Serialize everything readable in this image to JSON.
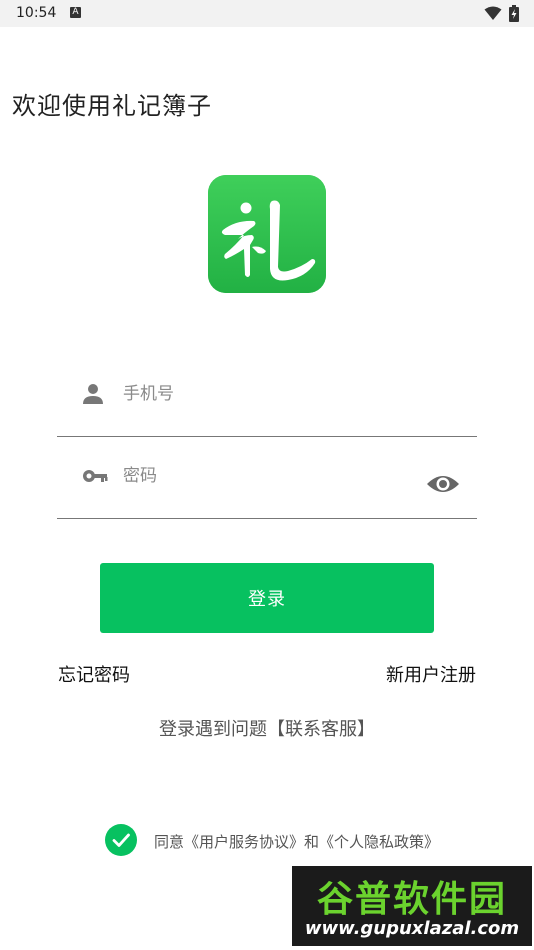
{
  "status_bar": {
    "time": "10:54",
    "notification_glyph": "A",
    "icons": [
      "wifi-icon",
      "battery-charging-icon"
    ]
  },
  "welcome_title": "欢迎使用礼记簿子",
  "logo": {
    "text": "礼",
    "color": "#2fbf4f"
  },
  "form": {
    "phone_placeholder": "手机号",
    "password_placeholder": "密码",
    "phone_icon": "person-icon",
    "password_icon": "key-icon",
    "toggle_icon": "eye-icon"
  },
  "login_button": {
    "label": "登录",
    "color": "#07c160"
  },
  "links": {
    "forgot": "忘记密码",
    "register": "新用户注册"
  },
  "help_text": "登录遇到问题【联系客服】",
  "agreement": {
    "checked": true,
    "text": "同意《用户服务协议》和《个人隐私政策》"
  },
  "watermark": {
    "title": "谷普软件园",
    "url": "www.gupuxlazal.com"
  }
}
